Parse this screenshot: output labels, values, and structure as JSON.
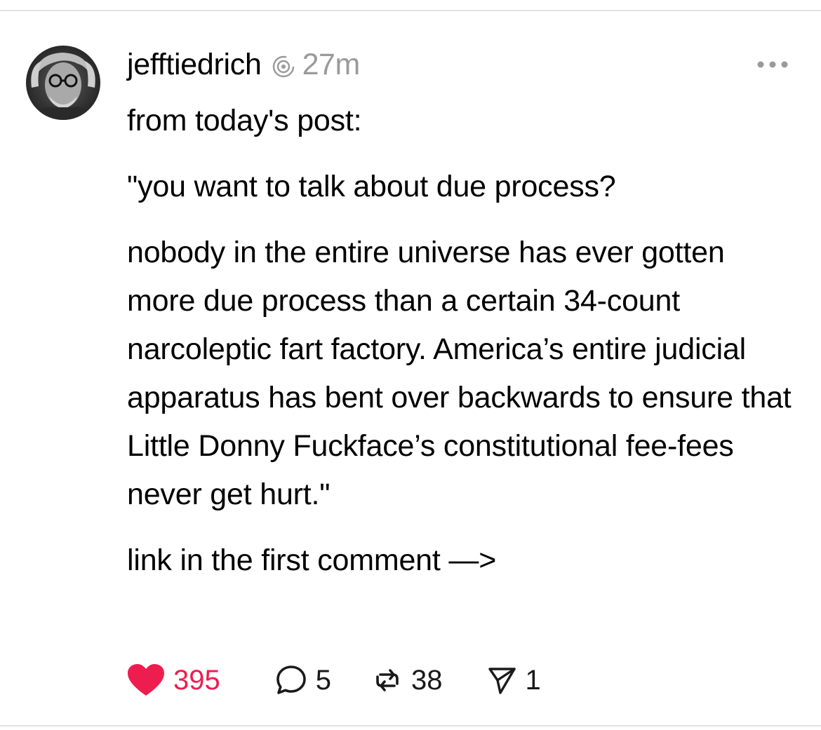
{
  "post": {
    "username": "jefftiedrich",
    "timestamp": "27m",
    "paragraphs": [
      "from today's post:",
      "\"you want to talk about due process?",
      "nobody in the entire universe has ever gotten more due process than a certain 34-count narcoleptic fart factory. America’s entire judicial apparatus has bent over backwards to ensure that Little Donny Fuckface’s constitutional fee-fees never get hurt.\"",
      "link in the first comment —>"
    ]
  },
  "actions": {
    "likes": "395",
    "replies": "5",
    "reposts": "38",
    "shares": "1"
  },
  "colors": {
    "like_accent": "#ee1d4f",
    "muted_text": "#9a9a9a",
    "divider": "#e3e3e3"
  },
  "icons": {
    "avatar": "avatar",
    "verified": "threads-badge-icon",
    "more": "more-options-icon",
    "like": "heart-icon",
    "reply": "comment-icon",
    "repost": "repost-icon",
    "share": "send-icon"
  }
}
